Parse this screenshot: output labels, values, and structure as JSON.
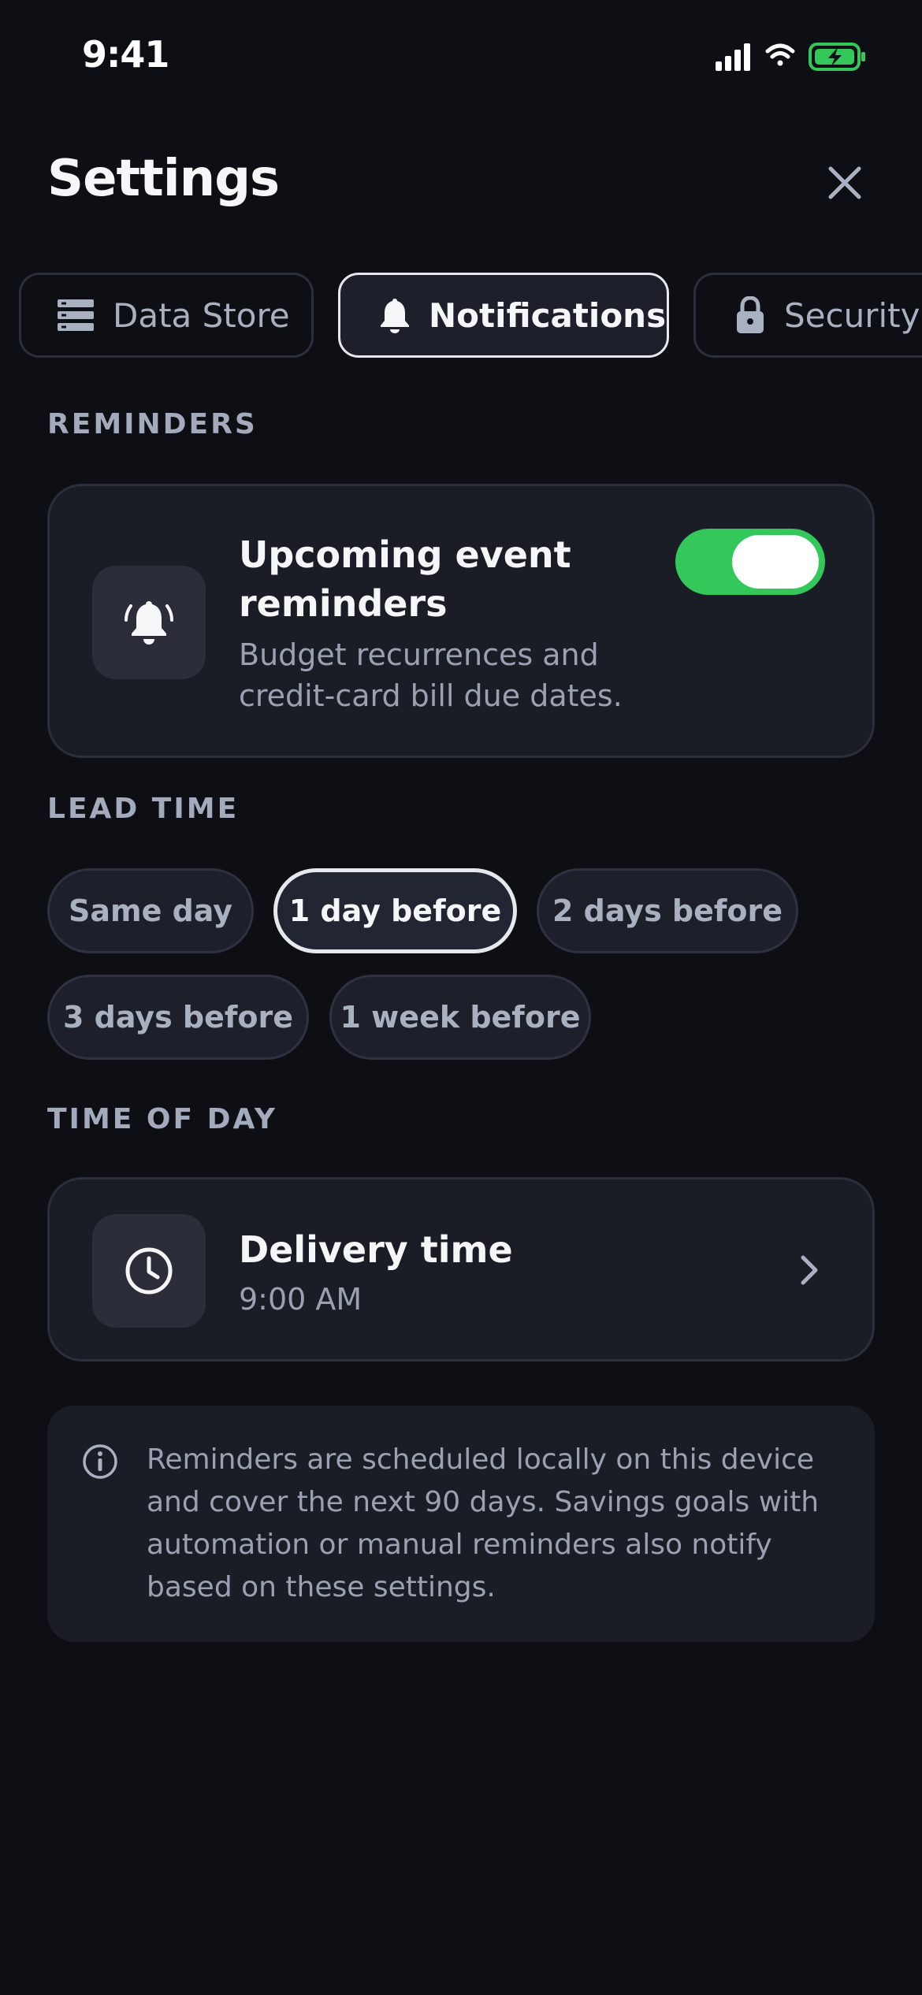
{
  "status_bar": {
    "time": "9:41"
  },
  "header": {
    "title": "Settings"
  },
  "tabs": [
    {
      "label": "Data Store",
      "icon": "database-icon",
      "active": false
    },
    {
      "label": "Notifications",
      "icon": "bell-icon",
      "active": true
    },
    {
      "label": "Security",
      "icon": "lock-icon",
      "active": false
    }
  ],
  "reminders": {
    "section_label": "REMINDERS",
    "title_line1": "Upcoming event",
    "title_line2": "reminders",
    "subtitle_line1": "Budget recurrences and",
    "subtitle_line2": "credit-card bill due dates.",
    "enabled": true
  },
  "lead_time": {
    "section_label": "LEAD TIME",
    "options": [
      "Same day",
      "1 day before",
      "2 days before",
      "3 days before",
      "1 week before"
    ],
    "selected": "1 day before"
  },
  "time_of_day": {
    "section_label": "TIME OF DAY",
    "title": "Delivery time",
    "value": "9:00 AM"
  },
  "info": {
    "text": "Reminders are scheduled locally on this device and cover the next 90 days. Savings goals with automation or manual reminders also notify based on these settings."
  },
  "colors": {
    "background": "#0e0f14",
    "card": "#1a1c26",
    "toggle_on": "#34c759",
    "battery": "#34c759"
  }
}
